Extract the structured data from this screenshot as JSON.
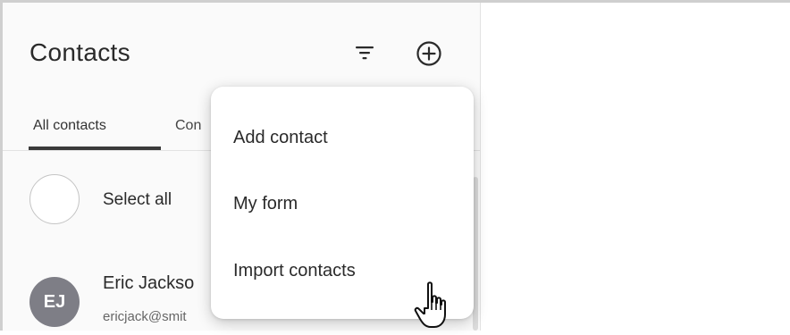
{
  "header": {
    "title": "Contacts",
    "filter_icon": "filter-icon",
    "add_icon": "plus-circle-icon"
  },
  "tabs": [
    {
      "label": "All contacts",
      "active": true
    },
    {
      "label": "Con",
      "active": false
    }
  ],
  "list": {
    "select_all_label": "Select all",
    "contacts": [
      {
        "initials": "EJ",
        "name": "Eric Jackso",
        "email": "ericjack@smit"
      }
    ]
  },
  "dropdown_menu": {
    "items": [
      "Add contact",
      "My form",
      "Import contacts"
    ]
  },
  "cursor": "hand-pointer-icon",
  "colors": {
    "panel_background": "#fafafa",
    "avatar_background": "#7e7e86",
    "tab_underline": "#3a3a3a"
  }
}
